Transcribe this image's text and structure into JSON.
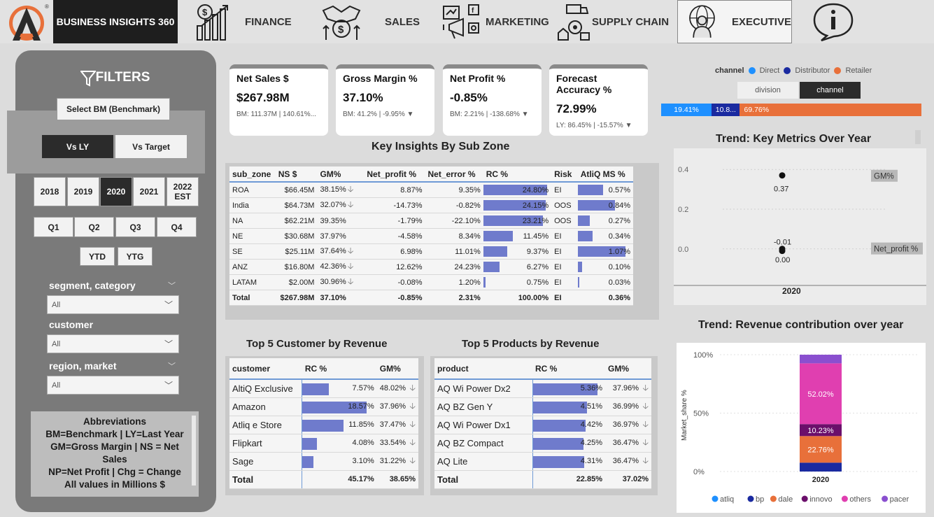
{
  "brand": "BUSINESS INSIGHTS 360",
  "nav": [
    {
      "label": "FINANCE",
      "icon": "finance-chart-icon"
    },
    {
      "label": "SALES",
      "icon": "handshake-money-icon"
    },
    {
      "label": "MARKETING",
      "icon": "marketing-megaphone-icon"
    },
    {
      "label": "SUPPLY CHAIN",
      "icon": "supply-chain-truck-icon"
    },
    {
      "label": "EXECUTIVE",
      "icon": "executive-person-icon"
    }
  ],
  "filters": {
    "title": "FILTERS",
    "select_bm": "Select BM (Benchmark)",
    "vs_ly": "Vs LY",
    "vs_target": "Vs Target",
    "years": [
      "2018",
      "2019",
      "2020",
      "2021",
      "2022 EST"
    ],
    "quarters": [
      "Q1",
      "Q2",
      "Q3",
      "Q4"
    ],
    "ytd": "YTD",
    "ytg": "YTG",
    "segment_label": "segment, category",
    "segment_value": "All",
    "customer_label": "customer",
    "customer_value": "All",
    "region_label": "region, market",
    "region_value": "All",
    "abbr_title": "Abbreviations",
    "abbr_lines": [
      "BM=Benchmark | LY=Last Year",
      "GM=Gross Margin | NS = Net",
      "Sales",
      "NP=Net Profit | Chg = Change",
      "All values in Millions $"
    ]
  },
  "kpis": [
    {
      "title": "Net Sales $",
      "value": "$267.98M",
      "sub": "BM: 111.37M | 140.61%..."
    },
    {
      "title": "Gross Margin %",
      "value": "37.10%",
      "sub": "BM: 41.2% | -9.95% ▼"
    },
    {
      "title": "Net Profit %",
      "value": "-0.85%",
      "sub": "BM: 2.21% | -138.68% ▼"
    },
    {
      "title": "Forecast Accuracy %",
      "value": "72.99%",
      "sub": "LY: 86.45% | -15.57% ▼"
    }
  ],
  "subzone": {
    "title": "Key Insights By Sub Zone",
    "headers": [
      "sub_zone",
      "NS $",
      "GM%",
      "Net_profit %",
      "Net_error %",
      "RC %",
      "Risk",
      "AtliQ MS %"
    ],
    "rows": [
      {
        "zone": "ROA",
        "ns": "$66.45M",
        "gm": "38.15%",
        "gm_arrow": true,
        "np": "8.87%",
        "ne": "9.35%",
        "rc": "24.80%",
        "rc_v": 24.8,
        "risk": "EI",
        "ms": "0.57%",
        "ms_v": 0.57
      },
      {
        "zone": "India",
        "ns": "$64.73M",
        "gm": "32.07%",
        "gm_arrow": true,
        "np": "-14.73%",
        "ne": "-0.82%",
        "rc": "24.15%",
        "rc_v": 24.15,
        "risk": "OOS",
        "ms": "0.84%",
        "ms_v": 0.84
      },
      {
        "zone": "NA",
        "ns": "$62.21M",
        "gm": "39.35%",
        "gm_arrow": false,
        "np": "-1.79%",
        "ne": "-22.10%",
        "rc": "23.21%",
        "rc_v": 23.21,
        "risk": "OOS",
        "ms": "0.27%",
        "ms_v": 0.27
      },
      {
        "zone": "NE",
        "ns": "$30.68M",
        "gm": "37.97%",
        "gm_arrow": false,
        "np": "-4.58%",
        "ne": "8.34%",
        "rc": "11.45%",
        "rc_v": 11.45,
        "risk": "EI",
        "ms": "0.34%",
        "ms_v": 0.34
      },
      {
        "zone": "SE",
        "ns": "$25.11M",
        "gm": "37.64%",
        "gm_arrow": true,
        "np": "6.98%",
        "ne": "11.01%",
        "rc": "9.37%",
        "rc_v": 9.37,
        "risk": "EI",
        "ms": "1.07%",
        "ms_v": 1.07
      },
      {
        "zone": "ANZ",
        "ns": "$16.80M",
        "gm": "42.36%",
        "gm_arrow": true,
        "np": "12.62%",
        "ne": "24.23%",
        "rc": "6.27%",
        "rc_v": 6.27,
        "risk": "EI",
        "ms": "0.10%",
        "ms_v": 0.1
      },
      {
        "zone": "LATAM",
        "ns": "$2.00M",
        "gm": "30.96%",
        "gm_arrow": true,
        "np": "-0.08%",
        "ne": "1.20%",
        "rc": "0.75%",
        "rc_v": 0.75,
        "risk": "EI",
        "ms": "0.03%",
        "ms_v": 0.03
      }
    ],
    "total": {
      "zone": "Total",
      "ns": "$267.98M",
      "gm": "37.10%",
      "np": "-0.85%",
      "ne": "2.31%",
      "rc": "100.00%",
      "risk": "EI",
      "ms": "0.36%"
    }
  },
  "top_customers": {
    "title": "Top 5 Customer by Revenue",
    "headers": [
      "customer",
      "RC %",
      "GM%"
    ],
    "rows": [
      {
        "name": "AltiQ Exclusive",
        "rc": "7.57%",
        "rc_v": 7.57,
        "gm": "48.02%"
      },
      {
        "name": "Amazon",
        "rc": "18.57%",
        "rc_v": 18.57,
        "gm": "37.96%"
      },
      {
        "name": "Atliq e Store",
        "rc": "11.85%",
        "rc_v": 11.85,
        "gm": "37.47%"
      },
      {
        "name": "Flipkart",
        "rc": "4.08%",
        "rc_v": 4.08,
        "gm": "33.54%"
      },
      {
        "name": "Sage",
        "rc": "3.10%",
        "rc_v": 3.1,
        "gm": "31.22%"
      }
    ],
    "total": {
      "name": "Total",
      "rc": "45.17%",
      "gm": "38.65%"
    }
  },
  "top_products": {
    "title": "Top 5 Products by Revenue",
    "headers": [
      "product",
      "RC %",
      "GM%"
    ],
    "rows": [
      {
        "name": "AQ Wi Power Dx2",
        "rc": "5.36%",
        "rc_v": 5.36,
        "gm": "37.96%"
      },
      {
        "name": "AQ BZ Gen Y",
        "rc": "4.51%",
        "rc_v": 4.51,
        "gm": "36.99%"
      },
      {
        "name": "AQ Wi Power Dx1",
        "rc": "4.42%",
        "rc_v": 4.42,
        "gm": "36.97%"
      },
      {
        "name": "AQ BZ Compact",
        "rc": "4.25%",
        "rc_v": 4.25,
        "gm": "36.47%"
      },
      {
        "name": "AQ Lite",
        "rc": "4.31%",
        "rc_v": 4.31,
        "gm": "36.47%"
      }
    ],
    "total": {
      "name": "Total",
      "rc": "22.85%",
      "gm": "37.02%"
    }
  },
  "channel": {
    "legend_title": "channel",
    "legend": [
      {
        "name": "Direct",
        "color": "#1e90ff"
      },
      {
        "name": "Distributor",
        "color": "#1a2aa0"
      },
      {
        "name": "Retailer",
        "color": "#e8703a"
      }
    ],
    "toggle": [
      "division",
      "channel"
    ],
    "bar": [
      {
        "label": "19.41%",
        "value": 19.41,
        "color": "#1e90ff"
      },
      {
        "label": "10.8...",
        "value": 10.83,
        "color": "#1a2aa0"
      },
      {
        "label": "69.76%",
        "value": 69.76,
        "color": "#e8703a"
      }
    ]
  },
  "chart_data": [
    {
      "type": "scatter",
      "title": "Trend: Key Metrics Over Year",
      "x": [
        "2020"
      ],
      "yticks": [
        "0.4",
        "0.2",
        "0.0"
      ],
      "ylim": [
        -0.05,
        0.45
      ],
      "series": [
        {
          "name": "GM%",
          "values": [
            0.37
          ],
          "label": "0.37"
        },
        {
          "name": "Net_profit %",
          "values": [
            -0.01
          ],
          "label": "-0.01"
        }
      ],
      "extra_label": "0.00"
    },
    {
      "type": "bar",
      "title": "Trend: Revenue contribution over year",
      "ylabel": "Market_share %",
      "yticks": [
        "100%",
        "50%",
        "0%"
      ],
      "categories": [
        "2020"
      ],
      "series": [
        {
          "name": "atliq",
          "values": [
            0.0
          ],
          "color": "#1e90ff"
        },
        {
          "name": "bp",
          "values": [
            7.59
          ],
          "color": "#1a2aa0"
        },
        {
          "name": "dale",
          "values": [
            22.76
          ],
          "color": "#e8703a",
          "label": "22.76%"
        },
        {
          "name": "innovo",
          "values": [
            10.23
          ],
          "color": "#6b0f6b",
          "label": "10.23%"
        },
        {
          "name": "others",
          "values": [
            52.02
          ],
          "color": "#e03fb0",
          "label": "52.02%"
        },
        {
          "name": "pacer",
          "values": [
            7.4
          ],
          "color": "#8a4fcf"
        }
      ]
    }
  ]
}
